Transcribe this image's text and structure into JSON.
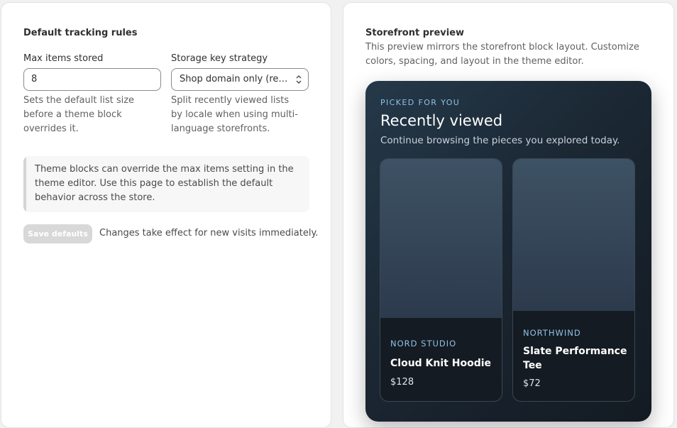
{
  "settings": {
    "title": "Default tracking rules",
    "max_items": {
      "label": "Max items stored",
      "value": "8",
      "help": "Sets the default list size before a theme block overrides it."
    },
    "storage_key": {
      "label": "Storage key strategy",
      "selected": "Shop domain only (reco...",
      "help": "Split recently viewed lists by locale when using multi-language storefronts."
    },
    "banner": "Theme blocks can override the max items setting in the theme editor. Use this page to establish the default behavior across the store.",
    "save_label": "Save defaults",
    "save_note": "Changes take effect for new visits immediately."
  },
  "preview": {
    "title": "Storefront preview",
    "subtitle": "This preview mirrors the storefront block layout. Customize colors, spacing, and layout in the theme editor.",
    "eyebrow": "PICKED FOR YOU",
    "heading": "Recently viewed",
    "caption": "Continue browsing the pieces you explored today.",
    "products": [
      {
        "vendor": "NORD STUDIO",
        "title": "Cloud Knit Hoodie",
        "price": "$128"
      },
      {
        "vendor": "NORTHWIND",
        "title": "Slate Performance Tee",
        "price": "$72"
      }
    ]
  },
  "colors": {
    "accent_text": "#8fc1e6",
    "disabled_button": "#d8d8d8",
    "preview_bg": "#1b2733"
  },
  "icons": {
    "select": "chevron-up-down-icon"
  }
}
